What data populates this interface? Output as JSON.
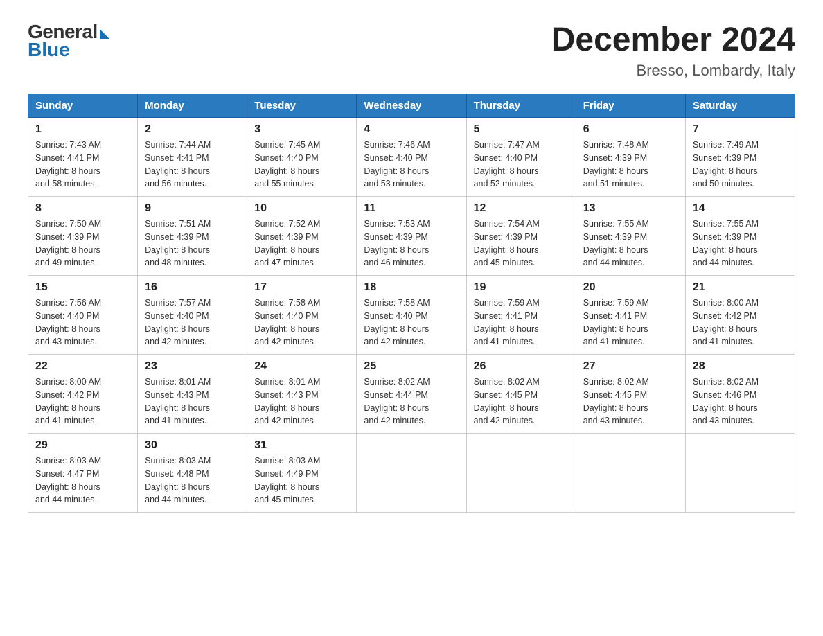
{
  "logo": {
    "general": "General",
    "blue": "Blue"
  },
  "title": {
    "month_year": "December 2024",
    "location": "Bresso, Lombardy, Italy"
  },
  "headers": [
    "Sunday",
    "Monday",
    "Tuesday",
    "Wednesday",
    "Thursday",
    "Friday",
    "Saturday"
  ],
  "weeks": [
    [
      {
        "day": "1",
        "sunrise": "7:43 AM",
        "sunset": "4:41 PM",
        "daylight": "8 hours and 58 minutes."
      },
      {
        "day": "2",
        "sunrise": "7:44 AM",
        "sunset": "4:41 PM",
        "daylight": "8 hours and 56 minutes."
      },
      {
        "day": "3",
        "sunrise": "7:45 AM",
        "sunset": "4:40 PM",
        "daylight": "8 hours and 55 minutes."
      },
      {
        "day": "4",
        "sunrise": "7:46 AM",
        "sunset": "4:40 PM",
        "daylight": "8 hours and 53 minutes."
      },
      {
        "day": "5",
        "sunrise": "7:47 AM",
        "sunset": "4:40 PM",
        "daylight": "8 hours and 52 minutes."
      },
      {
        "day": "6",
        "sunrise": "7:48 AM",
        "sunset": "4:39 PM",
        "daylight": "8 hours and 51 minutes."
      },
      {
        "day": "7",
        "sunrise": "7:49 AM",
        "sunset": "4:39 PM",
        "daylight": "8 hours and 50 minutes."
      }
    ],
    [
      {
        "day": "8",
        "sunrise": "7:50 AM",
        "sunset": "4:39 PM",
        "daylight": "8 hours and 49 minutes."
      },
      {
        "day": "9",
        "sunrise": "7:51 AM",
        "sunset": "4:39 PM",
        "daylight": "8 hours and 48 minutes."
      },
      {
        "day": "10",
        "sunrise": "7:52 AM",
        "sunset": "4:39 PM",
        "daylight": "8 hours and 47 minutes."
      },
      {
        "day": "11",
        "sunrise": "7:53 AM",
        "sunset": "4:39 PM",
        "daylight": "8 hours and 46 minutes."
      },
      {
        "day": "12",
        "sunrise": "7:54 AM",
        "sunset": "4:39 PM",
        "daylight": "8 hours and 45 minutes."
      },
      {
        "day": "13",
        "sunrise": "7:55 AM",
        "sunset": "4:39 PM",
        "daylight": "8 hours and 44 minutes."
      },
      {
        "day": "14",
        "sunrise": "7:55 AM",
        "sunset": "4:39 PM",
        "daylight": "8 hours and 44 minutes."
      }
    ],
    [
      {
        "day": "15",
        "sunrise": "7:56 AM",
        "sunset": "4:40 PM",
        "daylight": "8 hours and 43 minutes."
      },
      {
        "day": "16",
        "sunrise": "7:57 AM",
        "sunset": "4:40 PM",
        "daylight": "8 hours and 42 minutes."
      },
      {
        "day": "17",
        "sunrise": "7:58 AM",
        "sunset": "4:40 PM",
        "daylight": "8 hours and 42 minutes."
      },
      {
        "day": "18",
        "sunrise": "7:58 AM",
        "sunset": "4:40 PM",
        "daylight": "8 hours and 42 minutes."
      },
      {
        "day": "19",
        "sunrise": "7:59 AM",
        "sunset": "4:41 PM",
        "daylight": "8 hours and 41 minutes."
      },
      {
        "day": "20",
        "sunrise": "7:59 AM",
        "sunset": "4:41 PM",
        "daylight": "8 hours and 41 minutes."
      },
      {
        "day": "21",
        "sunrise": "8:00 AM",
        "sunset": "4:42 PM",
        "daylight": "8 hours and 41 minutes."
      }
    ],
    [
      {
        "day": "22",
        "sunrise": "8:00 AM",
        "sunset": "4:42 PM",
        "daylight": "8 hours and 41 minutes."
      },
      {
        "day": "23",
        "sunrise": "8:01 AM",
        "sunset": "4:43 PM",
        "daylight": "8 hours and 41 minutes."
      },
      {
        "day": "24",
        "sunrise": "8:01 AM",
        "sunset": "4:43 PM",
        "daylight": "8 hours and 42 minutes."
      },
      {
        "day": "25",
        "sunrise": "8:02 AM",
        "sunset": "4:44 PM",
        "daylight": "8 hours and 42 minutes."
      },
      {
        "day": "26",
        "sunrise": "8:02 AM",
        "sunset": "4:45 PM",
        "daylight": "8 hours and 42 minutes."
      },
      {
        "day": "27",
        "sunrise": "8:02 AM",
        "sunset": "4:45 PM",
        "daylight": "8 hours and 43 minutes."
      },
      {
        "day": "28",
        "sunrise": "8:02 AM",
        "sunset": "4:46 PM",
        "daylight": "8 hours and 43 minutes."
      }
    ],
    [
      {
        "day": "29",
        "sunrise": "8:03 AM",
        "sunset": "4:47 PM",
        "daylight": "8 hours and 44 minutes."
      },
      {
        "day": "30",
        "sunrise": "8:03 AM",
        "sunset": "4:48 PM",
        "daylight": "8 hours and 44 minutes."
      },
      {
        "day": "31",
        "sunrise": "8:03 AM",
        "sunset": "4:49 PM",
        "daylight": "8 hours and 45 minutes."
      },
      null,
      null,
      null,
      null
    ]
  ],
  "labels": {
    "sunrise": "Sunrise:",
    "sunset": "Sunset:",
    "daylight": "Daylight:"
  }
}
